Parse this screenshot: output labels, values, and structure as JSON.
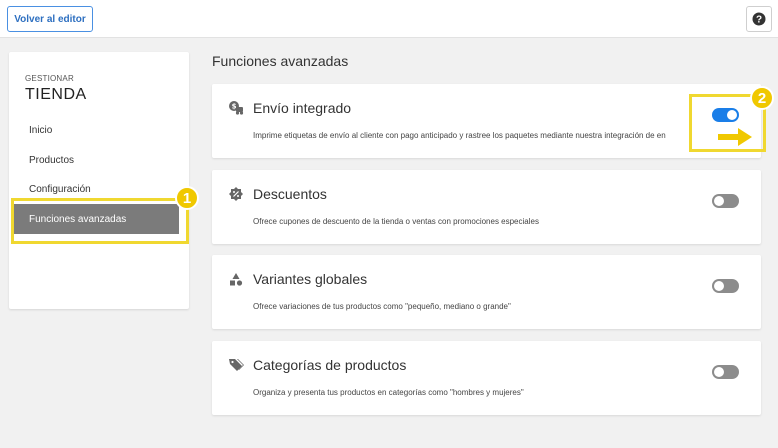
{
  "topbar": {
    "back_label": "Volver al editor",
    "help_label": "?"
  },
  "sidebar": {
    "caption": "GESTIONAR",
    "title": "TIENDA",
    "items": [
      {
        "label": "Inicio"
      },
      {
        "label": "Productos"
      },
      {
        "label": "Configuración"
      },
      {
        "label": "Funciones avanzadas",
        "active": true
      }
    ]
  },
  "main": {
    "section_title": "Funciones avanzadas",
    "features": [
      {
        "title": "Envío integrado",
        "description": "Imprime etiquetas de envío al cliente con pago anticipado y rastree los paquetes mediante nuestra integración de en",
        "enabled": true,
        "icon": "shipping-truck-icon"
      },
      {
        "title": "Descuentos",
        "description": "Ofrece cupones de descuento de la tienda o ventas con promociones especiales",
        "enabled": false,
        "icon": "discount-badge-icon"
      },
      {
        "title": "Variantes globales",
        "description": "Ofrece variaciones de tus productos como \"pequeño, mediano o grande\"",
        "enabled": false,
        "icon": "shapes-icon"
      },
      {
        "title": "Categorías de productos",
        "description": "Organiza y presenta tus productos en categorías como \"hombres y mujeres\"",
        "enabled": false,
        "icon": "tag-icon"
      }
    ]
  },
  "annotations": {
    "badge_1": "1",
    "badge_2": "2"
  },
  "colors": {
    "accent": "#1a7ee8",
    "highlight": "#f0d830",
    "badge": "#f0c800",
    "active_nav": "#7b7b7b"
  }
}
